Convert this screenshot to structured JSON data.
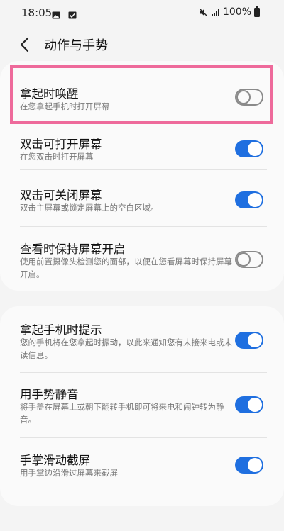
{
  "status_bar": {
    "time": "18:05",
    "battery": "100%",
    "icons": [
      "image-icon",
      "checkbox-icon",
      "mute-icon",
      "signal-icon",
      "battery-icon"
    ]
  },
  "header": {
    "title": "动作与手势",
    "back_icon": "chevron-left-icon"
  },
  "colors": {
    "accent": "#1f6fe0",
    "highlight_border": "#ee6a9b",
    "background": "#f4f4f4",
    "card": "#fafafa"
  },
  "section1": {
    "items": [
      {
        "title": "拿起时唤醒",
        "subtitle": "在您拿起手机时打开屏幕",
        "enabled": false
      },
      {
        "title": "双击可打开屏幕",
        "subtitle": "在您双击时打开屏幕",
        "enabled": true
      },
      {
        "title": "双击可关闭屏幕",
        "subtitle": "双击主屏幕或锁定屏幕上的空白区域。",
        "enabled": true
      },
      {
        "title": "查看时保持屏幕开启",
        "subtitle": "使用前置摄像头检测您的面部，以便在您看屏幕时保持屏幕开启。",
        "enabled": false
      }
    ]
  },
  "section2": {
    "items": [
      {
        "title": "拿起手机时提示",
        "subtitle": "您的手机将在您拿起时振动，以此来通知您有未接来电或未读信息。",
        "enabled": true
      },
      {
        "title": "用手势静音",
        "subtitle": "将手盖在屏幕上或朝下翻转手机即可将来电和闹钟转为静音。",
        "enabled": true
      },
      {
        "title": "手掌滑动截屏",
        "subtitle": "用手掌边沿滑过屏幕来截屏",
        "enabled": true
      }
    ]
  }
}
